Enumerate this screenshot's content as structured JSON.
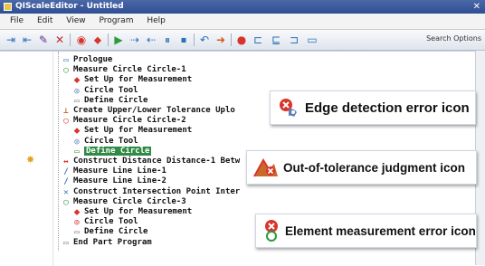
{
  "window": {
    "title": "QIScaleEditor - Untitled"
  },
  "menu": [
    "File",
    "Edit",
    "View",
    "Program",
    "Help"
  ],
  "toolbar": {
    "search_label": "Search Options",
    "icons": [
      "insert-icon",
      "insert-down-icon",
      "edit-icon",
      "delete-icon",
      "measure-icon",
      "tolerance-icon",
      "run-icon",
      "step-icon",
      "step-back-icon",
      "pause-icon",
      "stop-icon",
      "undo-icon",
      "redo-icon",
      "record-icon",
      "bracket-icon",
      "compare-icon",
      "export-icon",
      "window-icon"
    ]
  },
  "tree": [
    {
      "label": "Prologue",
      "indent": 0
    },
    {
      "label": "Measure Circle Circle-1",
      "indent": 0
    },
    {
      "label": "Set Up for Measurement",
      "indent": 1
    },
    {
      "label": "Circle Tool",
      "indent": 1
    },
    {
      "label": "Define Circle",
      "indent": 1
    },
    {
      "label": "Create Upper/Lower Tolerance Uplo",
      "indent": 0
    },
    {
      "label": "Measure Circle Circle-2",
      "indent": 0
    },
    {
      "label": "Set Up for Measurement",
      "indent": 1
    },
    {
      "label": "Circle Tool",
      "indent": 1
    },
    {
      "label": "Define Circle",
      "indent": 1,
      "selected": true
    },
    {
      "label": "Construct Distance Distance-1 Betw",
      "indent": 0
    },
    {
      "label": "Measure Line Line-1",
      "indent": 0
    },
    {
      "label": "Measure Line Line-2",
      "indent": 0
    },
    {
      "label": "Construct Intersection Point Inter",
      "indent": 0
    },
    {
      "label": "Measure Circle Circle-3",
      "indent": 0
    },
    {
      "label": "Set Up for Measurement",
      "indent": 1
    },
    {
      "label": "Circle Tool",
      "indent": 1
    },
    {
      "label": "Define Circle",
      "indent": 1
    },
    {
      "label": "End Part Program",
      "indent": 0
    }
  ],
  "callouts": {
    "edge": "Edge detection error icon",
    "tolerance": "Out-of-tolerance judgment icon",
    "element": "Element measurement error icon"
  },
  "colors": {
    "titlebar": "#3a5a9e",
    "selected": "#2f8a45",
    "error": "#d9342b",
    "edge_icon": "#5c7fb5"
  }
}
